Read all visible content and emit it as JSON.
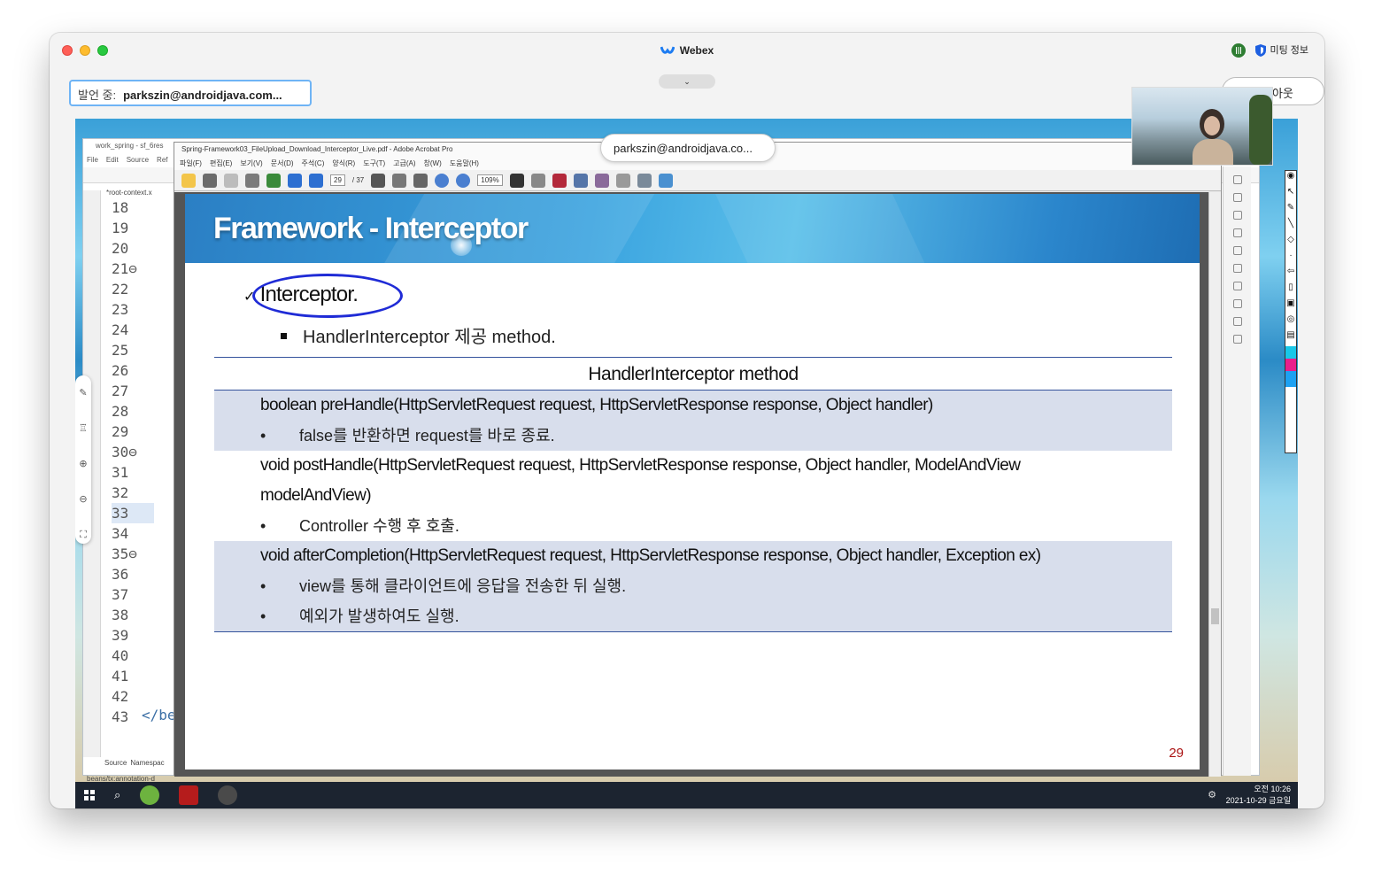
{
  "window": {
    "app_title": "Webex",
    "meeting_info_label": "미팅 정보",
    "speaker_label": "발언 중:",
    "speaker_name": "parkszin@androidjava.com...",
    "layout_label": "이아웃",
    "presenter_pill": "parkszin@androidjava.co..."
  },
  "eclipse": {
    "title": "work_spring - sf_6res",
    "menu": [
      "File",
      "Edit",
      "Source",
      "Ref"
    ],
    "tab": "*root-context.x",
    "line_numbers": [
      "18",
      "19",
      "20",
      "21⊖",
      "22",
      "23",
      "24",
      "25",
      "26",
      "27",
      "28",
      "29",
      "30⊖",
      "31",
      "32",
      "33",
      "34",
      "35⊖",
      "36",
      "37",
      "38",
      "39",
      "40",
      "41",
      "42",
      "43"
    ],
    "code_line_42": "</be",
    "bottom_tabs": [
      "Source",
      "Namespac"
    ],
    "status": "beans/tx:annotation-d"
  },
  "acrobat": {
    "title": "Spring-Framework03_FileUpload_Download_Interceptor_Live.pdf - Adobe Acrobat Pro",
    "menu": [
      "파일(F)",
      "편집(E)",
      "보기(V)",
      "문서(D)",
      "주석(C)",
      "양식(R)",
      "도구(T)",
      "고급(A)",
      "창(W)",
      "도움말(H)"
    ],
    "page_current": "29",
    "page_total": "/ 37",
    "zoom": "109%"
  },
  "slide": {
    "title": "Framework - Interceptor",
    "bullet": "Interceptor.",
    "check": "✓",
    "sub_bullet": "HandlerInterceptor 제공 method.",
    "table_header": "HandlerInterceptor method",
    "rows": [
      {
        "signature": "boolean preHandle(HttpServletRequest request, HttpServletResponse response,  Object  handler)",
        "descriptions": [
          "false를 반환하면 request를 바로 종료."
        ]
      },
      {
        "signature": "void postHandle(HttpServletRequest request, HttpServletResponse response,  Object  handler, ModelAndView",
        "signature_cont": "modelAndView)",
        "descriptions": [
          "Controller 수행 후 호출."
        ]
      },
      {
        "signature": "void afterCompletion(HttpServletRequest request, HttpServletResponse response, Object  handler, Exception ex)",
        "descriptions": [
          "view를 통해 클라이언트에 응답을 전송한 뒤 실행.",
          "예외가 발생하여도 실행."
        ]
      }
    ],
    "page_number": "29",
    "bullet_glyph": "•"
  },
  "taskbar": {
    "time": "오전 10:26",
    "date": "2021-10-29 금요일"
  },
  "colors": {
    "banner": "#2b86cc",
    "table_shade": "#d8deec",
    "circle_annotation": "#1f2bd6",
    "page_number": "#aa1111"
  }
}
